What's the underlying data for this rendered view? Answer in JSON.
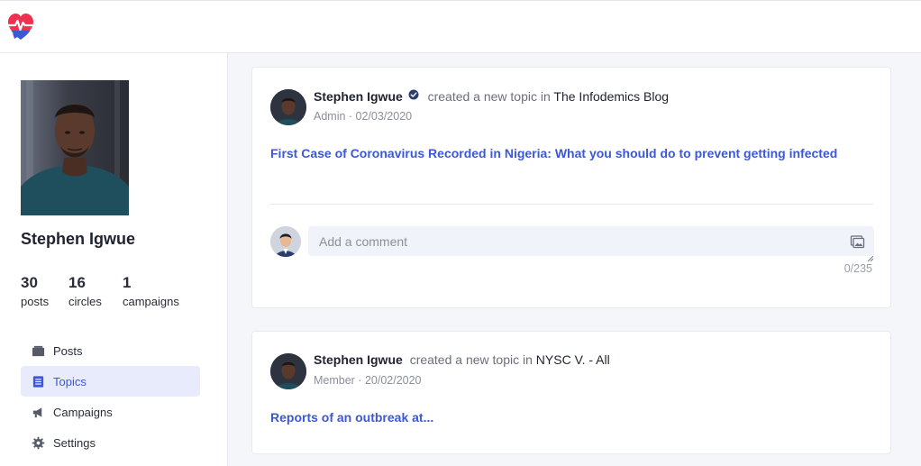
{
  "app": {
    "logo_icon": "heartbeat-heart-chat-icon",
    "brand_colors": {
      "primary": "#3d58d6",
      "logo_red": "#f0304f",
      "logo_blue": "#3d58d6"
    }
  },
  "profile": {
    "name": "Stephen Igwue",
    "stats": [
      {
        "value": "30",
        "label": "posts"
      },
      {
        "value": "16",
        "label": "circles"
      },
      {
        "value": "1",
        "label": "campaigns"
      }
    ]
  },
  "nav": {
    "items": [
      {
        "label": "Posts",
        "icon": "posts-icon",
        "active": false
      },
      {
        "label": "Topics",
        "icon": "topics-icon",
        "active": true
      },
      {
        "label": "Campaigns",
        "icon": "megaphone-icon",
        "active": false
      },
      {
        "label": "Settings",
        "icon": "gear-icon",
        "active": false
      }
    ]
  },
  "feed": [
    {
      "author": "Stephen Igwue",
      "verified": true,
      "action": "created a new topic in",
      "target": "The Infodemics Blog",
      "meta": "Admin · 02/03/2020",
      "title": "First Case of Coronavirus Recorded in Nigeria: What you should do to prevent getting infected",
      "comment": {
        "placeholder": "Add a comment",
        "counter": "0/235",
        "attach_icon": "image-icon"
      }
    },
    {
      "author": "Stephen Igwue",
      "verified": false,
      "action": "created a new topic in",
      "target": "NYSC V. - All",
      "meta": "Member · 20/02/2020",
      "title": "Reports of an outbreak at..."
    }
  ]
}
